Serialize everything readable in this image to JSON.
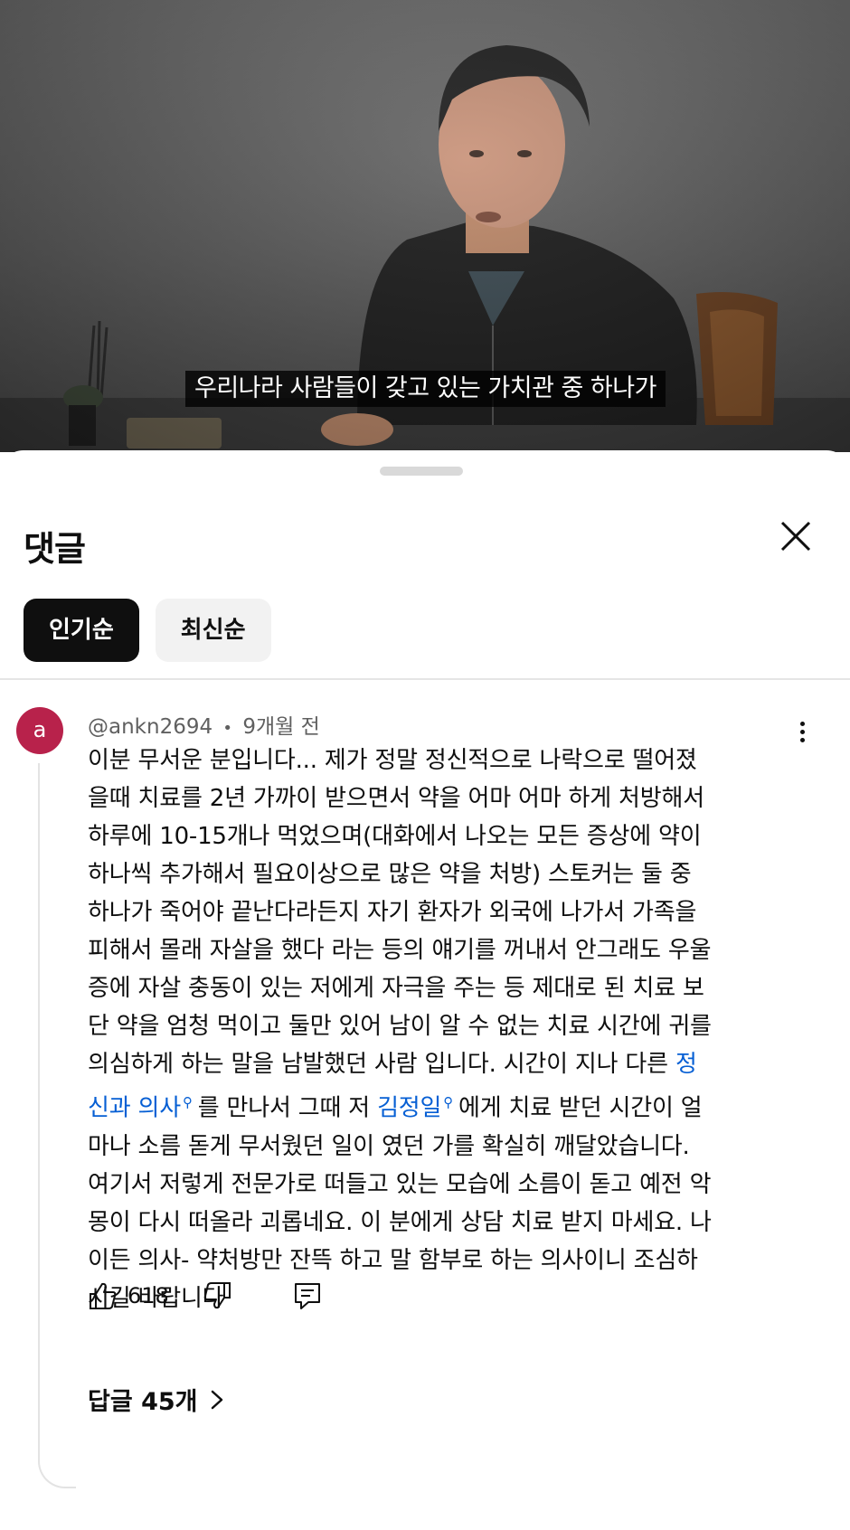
{
  "video": {
    "subtitle": "우리나라 사람들이 갖고 있는 가치관 중 하나가"
  },
  "sheet": {
    "title": "댓글",
    "sort_chips": [
      {
        "label": "인기순",
        "selected": true
      },
      {
        "label": "최신순",
        "selected": false
      }
    ]
  },
  "comment": {
    "avatar_letter": "a",
    "avatar_color": "#b8224b",
    "author": "@ankn2694",
    "separator": "•",
    "time": "9개월 전",
    "text_part1": "이분 무서운 분입니다... 제가 정말 정신적으로 나락으로 떨어졌\n을때 치료를 2년 가까이 받으면서 약을 어마 어마 하게 처방해서\n하루에 10-15개나 먹었으며(대화에서 나오는 모든 증상에 약이\n하나씩 추가해서 필요이상으로 많은 약을 처방) 스토커는 둘 중\n하나가 죽어야 끝난다라든지 자기 환자가 외국에 나가서 가족을\n피해서 몰래 자살을 했다 라는 등의 얘기를 꺼내서 안그래도 우울\n증에 자살 충동이 있는 저에게 자극을 주는 등 제대로 된 치료 보\n단 약을 엄청 먹이고 둘만 있어 남이 알 수 없는 치료 시간에 귀를\n의심하게 하는 말을 남발했던 사람 입니다. 시간이 지나 다른 ",
    "link1": "정\n신과 의사",
    "text_part2": "를 만나서 그때 저 ",
    "link2": "김정일",
    "text_part3": "에게 치료 받던 시간이 얼\n마나 소름 돋게 무서웠던 일이 였던 가를 확실히 깨달았습니다.\n여기서 저렇게 전문가로 떠들고 있는 모습에 소름이 돋고 예전 악\n몽이 다시 떠올라 괴롭네요. 이 분에게 상담 치료 받지 마세요. 나\n이든 의사- 약처방만 잔뜩 하고 말 함부로 하는 의사이니 조심하\n시길 바랍니다",
    "like_count": "618",
    "link_color": "#065fd4"
  },
  "replies": {
    "label": "답글 45개"
  }
}
